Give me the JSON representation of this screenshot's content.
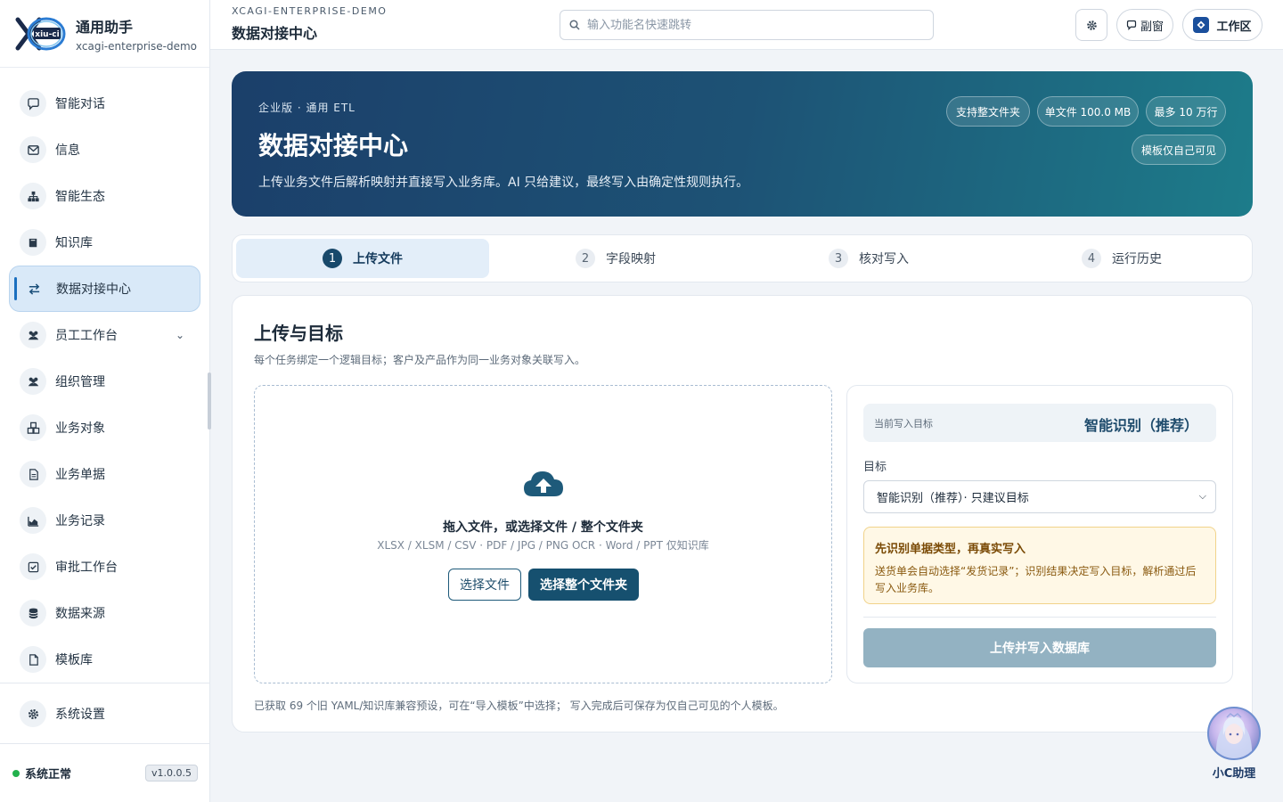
{
  "app": {
    "title": "通用助手",
    "subtitle": "xcagi-enterprise-demo",
    "logo_text": "xiu-ci"
  },
  "sidebar": {
    "items": [
      {
        "label": "智能对话",
        "icon": "chat-icon"
      },
      {
        "label": "信息",
        "icon": "mail-icon"
      },
      {
        "label": "智能生态",
        "icon": "network-icon"
      },
      {
        "label": "知识库",
        "icon": "book-icon"
      },
      {
        "label": "数据对接中心",
        "icon": "exchange-icon",
        "active": true
      },
      {
        "label": "员工工作台",
        "icon": "users-icon",
        "expandable": true
      },
      {
        "label": "组织管理",
        "icon": "users-icon"
      },
      {
        "label": "业务对象",
        "icon": "cubes-icon"
      },
      {
        "label": "业务单据",
        "icon": "document-icon"
      },
      {
        "label": "业务记录",
        "icon": "chart-icon"
      },
      {
        "label": "审批工作台",
        "icon": "check-icon"
      },
      {
        "label": "数据来源",
        "icon": "database-icon"
      },
      {
        "label": "模板库",
        "icon": "file-icon"
      }
    ],
    "settings_label": "系统设置",
    "status_label": "系统正常",
    "version": "v1.0.0.5"
  },
  "header": {
    "breadcrumb": "XCAGI-ENTERPRISE-DEMO",
    "title": "数据对接中心",
    "search_placeholder": "输入功能名快速跳转",
    "sub_window_label": "副窗",
    "workspace_label": "工作区"
  },
  "hero": {
    "kicker": "企业版 · 通用 ETL",
    "title": "数据对接中心",
    "description": "上传业务文件后解析映射并直接写入业务库。AI 只给建议，最终写入由确定性规则执行。",
    "pills": [
      "支持整文件夹",
      "单文件 100.0 MB",
      "最多 10 万行",
      "模板仅自己可见"
    ]
  },
  "steps": [
    {
      "num": "1",
      "label": "上传文件",
      "active": true
    },
    {
      "num": "2",
      "label": "字段映射"
    },
    {
      "num": "3",
      "label": "核对写入"
    },
    {
      "num": "4",
      "label": "运行历史"
    }
  ],
  "upload": {
    "title": "上传与目标",
    "description": "每个任务绑定一个逻辑目标；客户及产品作为同一业务对象关联写入。",
    "drop_title": "拖入文件，或选择文件 / 整个文件夹",
    "drop_formats": "XLSX / XLSM / CSV · PDF / JPG / PNG OCR · Word / PPT 仅知识库",
    "choose_file": "选择文件",
    "choose_folder": "选择整个文件夹",
    "footer": "已获取 69 个旧 YAML/知识库兼容预设，可在“导入模板”中选择； 写入完成后可保存为仅自己可见的个人模板。"
  },
  "target": {
    "current_label": "当前写入目标",
    "current_value": "智能识别（推荐）",
    "field_label": "目标",
    "selected_option": "智能识别（推荐）· 只建议目标",
    "notice_title": "先识别单据类型，再真实写入",
    "notice_body": "送货单会自动选择“发货记录”；识别结果决定写入目标，解析通过后写入业务库。",
    "submit_label": "上传并写入数据库"
  },
  "assistant": {
    "label": "小C助理"
  },
  "colors": {
    "primary": "#16506f",
    "active_nav": "#d9e9f8",
    "status_ok": "#22b14c",
    "notice_bg": "#fff8e6",
    "disabled_button": "#93b2c2"
  }
}
